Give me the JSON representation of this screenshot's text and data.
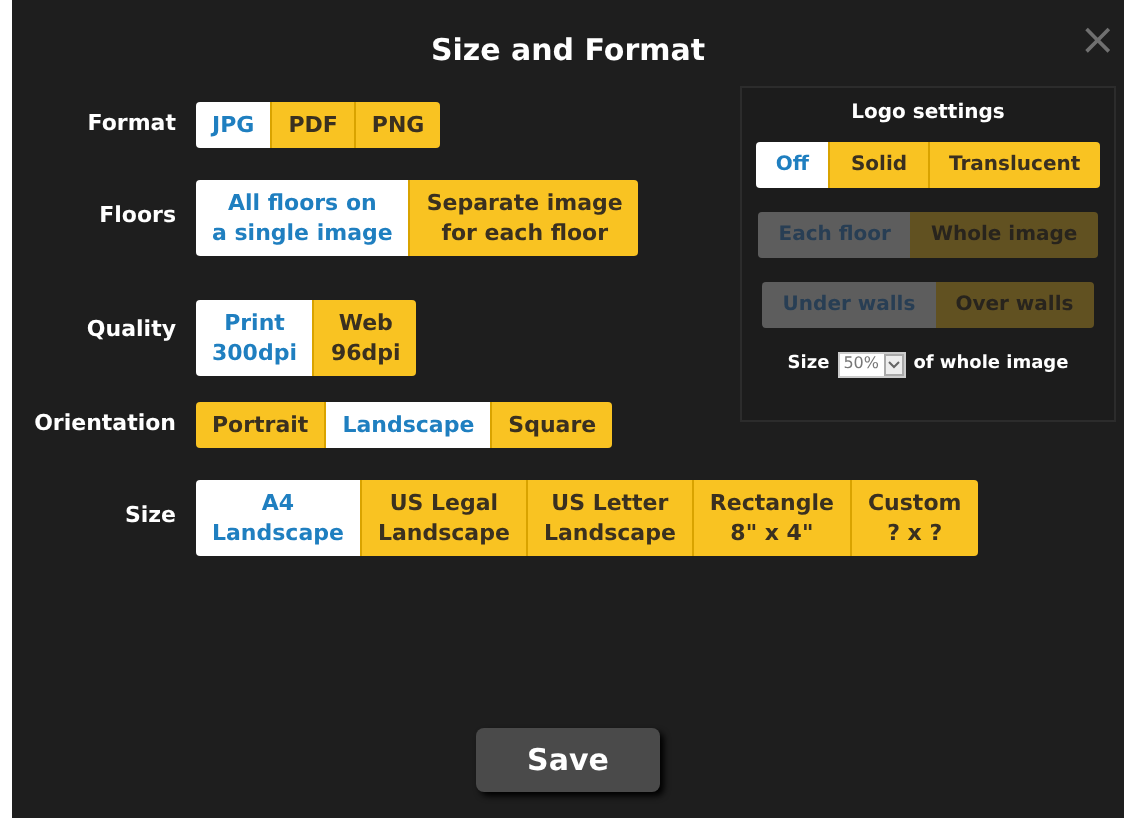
{
  "dialog": {
    "title": "Size and Format",
    "close": "×"
  },
  "settings": [
    {
      "label": "Format",
      "options": [
        {
          "lines": [
            "JPG"
          ],
          "selected": true
        },
        {
          "lines": [
            "PDF"
          ],
          "selected": false
        },
        {
          "lines": [
            "PNG"
          ],
          "selected": false
        }
      ]
    },
    {
      "label": "Floors",
      "options": [
        {
          "lines": [
            "All floors on",
            "a single image"
          ],
          "selected": true
        },
        {
          "lines": [
            "Separate image",
            "for each floor"
          ],
          "selected": false
        }
      ]
    },
    {
      "label": "Quality",
      "options": [
        {
          "lines": [
            "Print",
            "300dpi"
          ],
          "selected": true
        },
        {
          "lines": [
            "Web",
            "96dpi"
          ],
          "selected": false
        }
      ]
    },
    {
      "label": "Orientation",
      "options": [
        {
          "lines": [
            "Portrait"
          ],
          "selected": false
        },
        {
          "lines": [
            "Landscape"
          ],
          "selected": true
        },
        {
          "lines": [
            "Square"
          ],
          "selected": false
        }
      ]
    },
    {
      "label": "Size",
      "options": [
        {
          "lines": [
            "A4",
            "Landscape"
          ],
          "selected": true
        },
        {
          "lines": [
            "US Legal",
            "Landscape"
          ],
          "selected": false
        },
        {
          "lines": [
            "US Letter",
            "Landscape"
          ],
          "selected": false
        },
        {
          "lines": [
            "Rectangle",
            "8\" x 4\""
          ],
          "selected": false
        },
        {
          "lines": [
            "Custom",
            "? x ?"
          ],
          "selected": false
        }
      ]
    }
  ],
  "logo_settings": {
    "title": "Logo settings",
    "groups": [
      {
        "disabled": false,
        "options": [
          {
            "label": "Off",
            "selected": true
          },
          {
            "label": "Solid",
            "selected": false
          },
          {
            "label": "Translucent",
            "selected": false
          }
        ]
      },
      {
        "disabled": true,
        "options": [
          {
            "label": "Each floor",
            "selected": true
          },
          {
            "label": "Whole image",
            "selected": false
          }
        ]
      },
      {
        "disabled": true,
        "options": [
          {
            "label": "Under walls",
            "selected": true
          },
          {
            "label": "Over walls",
            "selected": false
          }
        ]
      }
    ],
    "size": {
      "label": "Size",
      "value": "50%",
      "disabled": true,
      "suffix": "of whole image"
    }
  },
  "save_button": "Save"
}
